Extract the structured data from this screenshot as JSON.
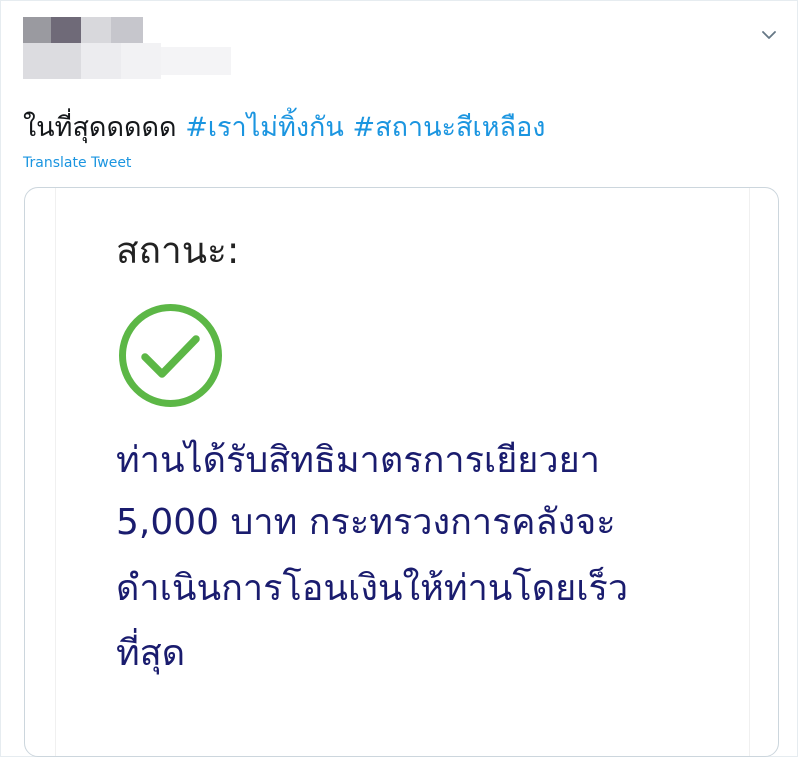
{
  "tweet": {
    "text_plain": "ในที่สุดดดดด",
    "hashtags": [
      "#เราไม่ทิ้งกัน",
      "#สถานะสีเหลือง"
    ],
    "translate_label": "Translate Tweet",
    "menu_icon": "chevron-down-icon"
  },
  "card": {
    "status_label": "สถานะ:",
    "icon": "check-circle-icon",
    "icon_color": "#5cb746",
    "text_color": "#1a1c6e",
    "message_lines": [
      "ท่านได้รับสิทธิมาตรการเยียวยา",
      "5,000 บาท กระทรวงการคลังจะ",
      "ดำเนินการโอนเงินให้ท่านโดยเร็ว",
      "ที่สุด"
    ]
  },
  "colors": {
    "link": "#1b95e0",
    "text": "#14171a"
  }
}
